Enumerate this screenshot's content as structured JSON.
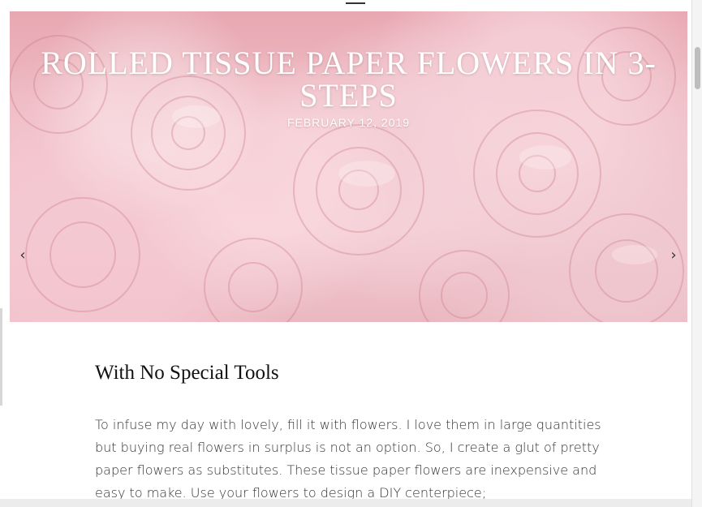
{
  "hero": {
    "title": "ROLLED TISSUE PAPER FLOWERS IN 3-STEPS",
    "date": "FEBRUARY 12, 2019",
    "prev_icon": "chevron-left-icon",
    "next_icon": "chevron-right-icon",
    "prev_glyph": "‹",
    "next_glyph": "›"
  },
  "post": {
    "heading": "With No Special Tools",
    "paragraph": "To infuse my day with lovely, fill it with flowers. I love them in large quantities but buying real flowers in surplus is not an option. So, I create a glut of pretty paper flowers as substitutes. These tissue paper flowers are inexpensive and easy to make. Use your flowers to design a DIY centerpiece;"
  },
  "colors": {
    "hero_pink": "#efbcc4",
    "text": "#333333",
    "heading": "#111111"
  }
}
